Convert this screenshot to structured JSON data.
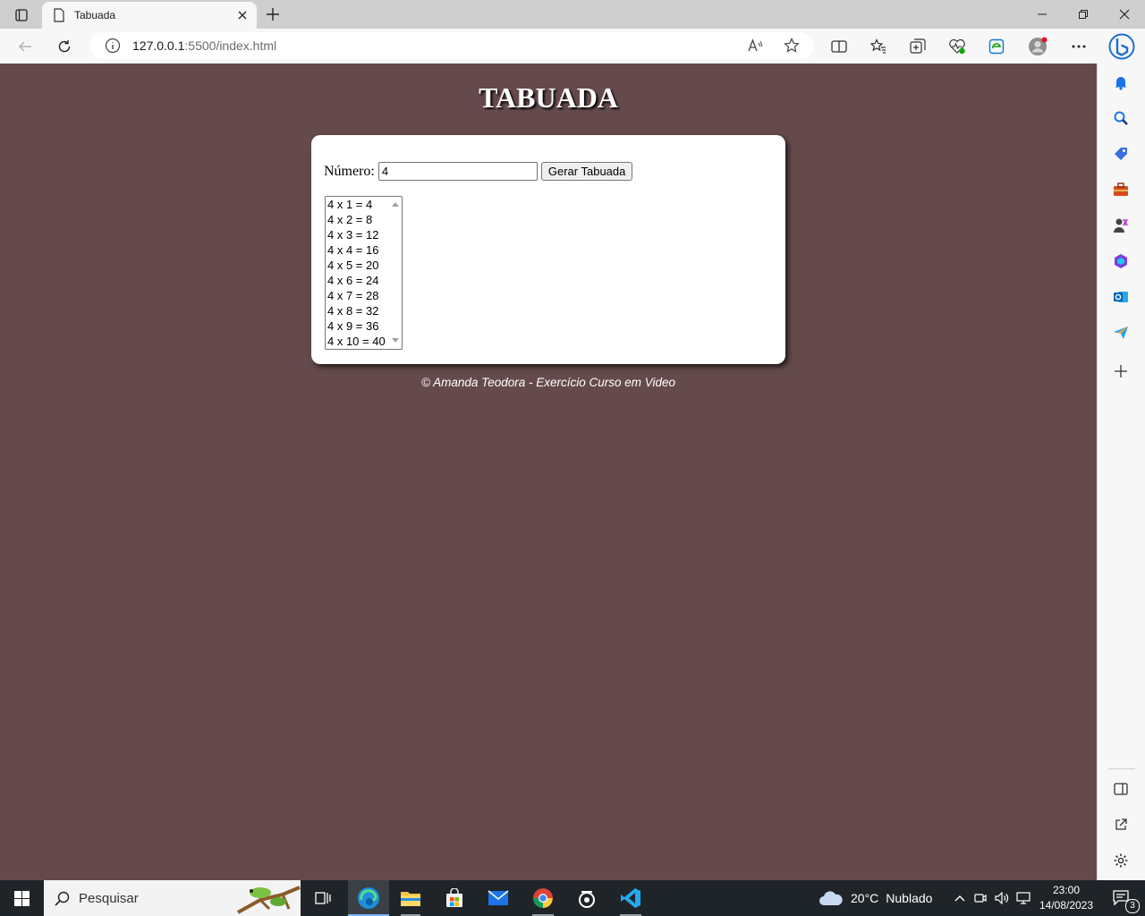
{
  "browser": {
    "tab_title": "Tabuada",
    "url_host": "127.0.0.1",
    "url_rest": ":5500/index.html",
    "accent": "#0078d4"
  },
  "page": {
    "title": "TABUADA",
    "number_label": "Número:",
    "number_value": "4",
    "button_label": "Gerar Tabuada",
    "results": [
      "4 x 1 = 4",
      "4 x 2 = 8",
      "4 x 3 = 12",
      "4 x 4 = 16",
      "4 x 5 = 20",
      "4 x 6 = 24",
      "4 x 7 = 28",
      "4 x 8 = 32",
      "4 x 9 = 36",
      "4 x 10 = 40"
    ],
    "footer": "© Amanda Teodora - Exercício Curso em Video",
    "background_color": "#654a4c"
  },
  "sidebar": {
    "icons": [
      "bell-icon",
      "search-icon",
      "tag-icon",
      "toolbox-icon",
      "games-icon",
      "office-icon",
      "outlook-icon",
      "send-icon",
      "add-icon",
      "sidebar-toggle-icon",
      "open-external-icon",
      "settings-icon"
    ]
  },
  "taskbar": {
    "search_placeholder": "Pesquisar",
    "weather_temp": "20°C",
    "weather_desc": "Nublado",
    "time": "23:00",
    "date": "14/08/2023",
    "notification_count": "3"
  }
}
